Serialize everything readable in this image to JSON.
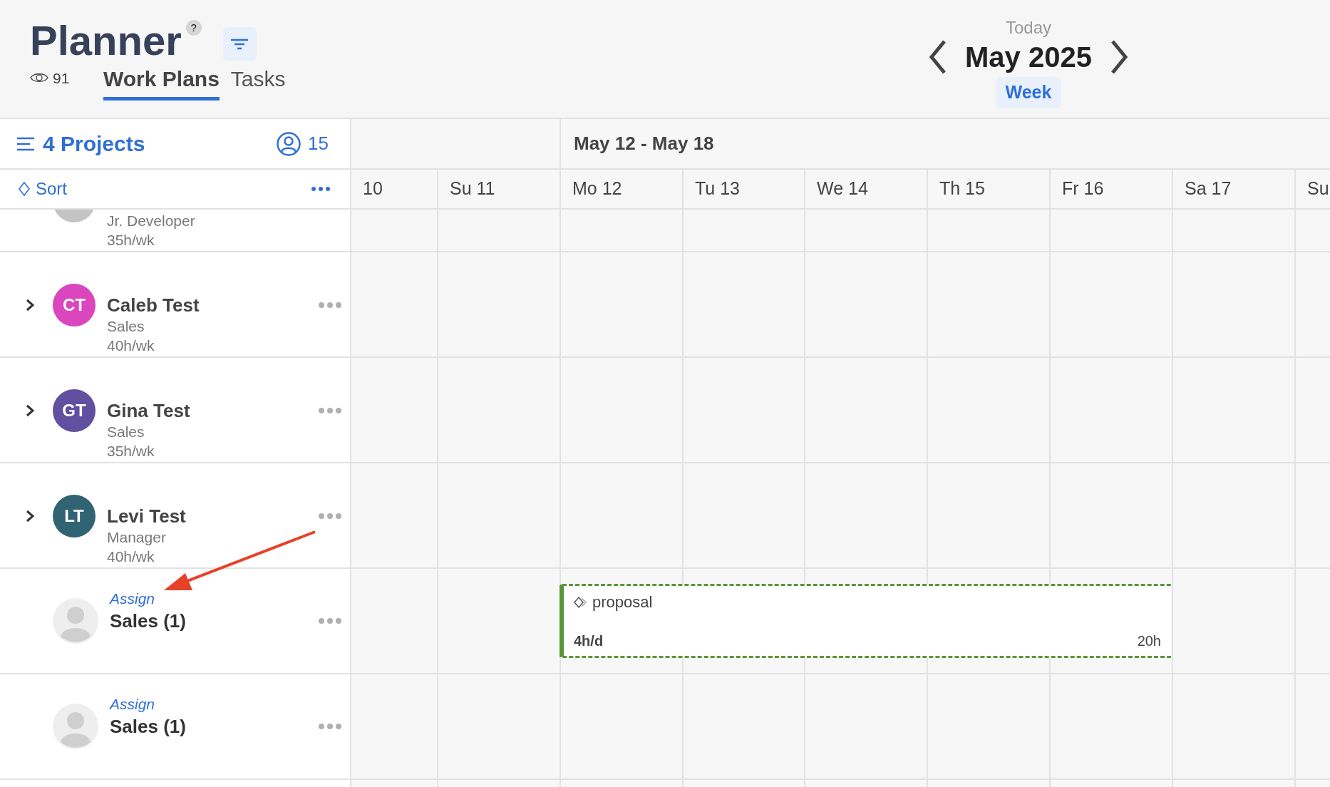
{
  "header": {
    "title": "Planner",
    "help": "?",
    "views": "91",
    "tabs": [
      {
        "label": "Work Plans",
        "selected": true
      },
      {
        "label": "Tasks",
        "selected": false
      }
    ],
    "date_nav": {
      "today": "Today",
      "period": "May 2025",
      "view": "Week"
    }
  },
  "panel": {
    "projects": "4 Projects",
    "people": "15",
    "sort": "Sort"
  },
  "timeline": {
    "week_label": "May 12 - May 18",
    "days": [
      "10",
      "Su 11",
      "Mo 12",
      "Tu 13",
      "We 14",
      "Th 15",
      "Fr 16",
      "Sa 17",
      "Su"
    ]
  },
  "rows": [
    {
      "kind": "partial",
      "color": "#c4c4c4",
      "role": "Jr. Developer",
      "hours": "35h/wk"
    },
    {
      "kind": "member",
      "initials": "CT",
      "color": "#db45be",
      "name": "Caleb Test",
      "role": "Sales",
      "hours": "40h/wk",
      "expanded": false
    },
    {
      "kind": "member",
      "initials": "GT",
      "color": "#614fa0",
      "name": "Gina Test",
      "role": "Sales",
      "hours": "35h/wk",
      "expanded": false
    },
    {
      "kind": "member",
      "initials": "LT",
      "color": "#316473",
      "name": "Levi Test",
      "role": "Manager",
      "hours": "40h/wk",
      "expanded": false
    },
    {
      "kind": "open_role",
      "link": "Assign",
      "name": "Sales (1)",
      "bar": {
        "title": "proposal",
        "rate": "4h/d",
        "total": "20h"
      }
    },
    {
      "kind": "open_role",
      "link": "Assign",
      "name": "Sales (1)"
    }
  ]
}
